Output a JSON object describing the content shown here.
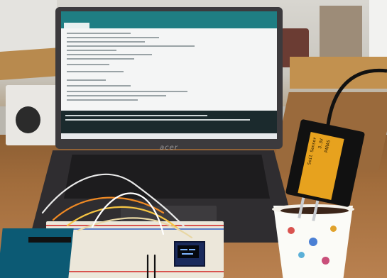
{
  "photo": {
    "laptop_brand": "acer",
    "sensor_label_lines": [
      "Soil Sensor",
      "3.3V",
      "PARAS"
    ],
    "colors": {
      "ide_teal": "#1f7e83",
      "sensor_label": "#e7a21e",
      "arduino_board": "#0c5a74",
      "oled_module": "#1a2a5c",
      "table_wood": "#a26d3c",
      "cup": "#fbfbf7"
    }
  }
}
